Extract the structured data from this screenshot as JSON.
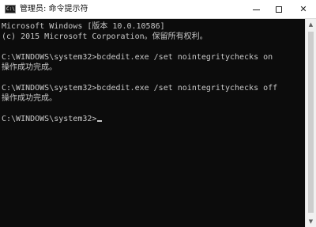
{
  "window": {
    "title": "管理员: 命令提示符",
    "icon_label": "C:\\",
    "controls": {
      "minimize_icon": "minimize-icon",
      "maximize_icon": "maximize-icon",
      "close_glyph": "✕"
    }
  },
  "console": {
    "lines": [
      "Microsoft Windows [版本 10.0.10586]",
      "(c) 2015 Microsoft Corporation。保留所有权利。",
      "",
      "C:\\WINDOWS\\system32>bcdedit.exe /set nointegritychecks on",
      "操作成功完成。",
      "",
      "C:\\WINDOWS\\system32>bcdedit.exe /set nointegritychecks off",
      "操作成功完成。",
      "",
      "C:\\WINDOWS\\system32>"
    ]
  },
  "scrollbar": {
    "up_glyph": "▲",
    "down_glyph": "▼"
  },
  "colors": {
    "console_bg": "#0c0c0c",
    "console_text": "#c8c8c8",
    "titlebar_bg": "#ffffff"
  }
}
